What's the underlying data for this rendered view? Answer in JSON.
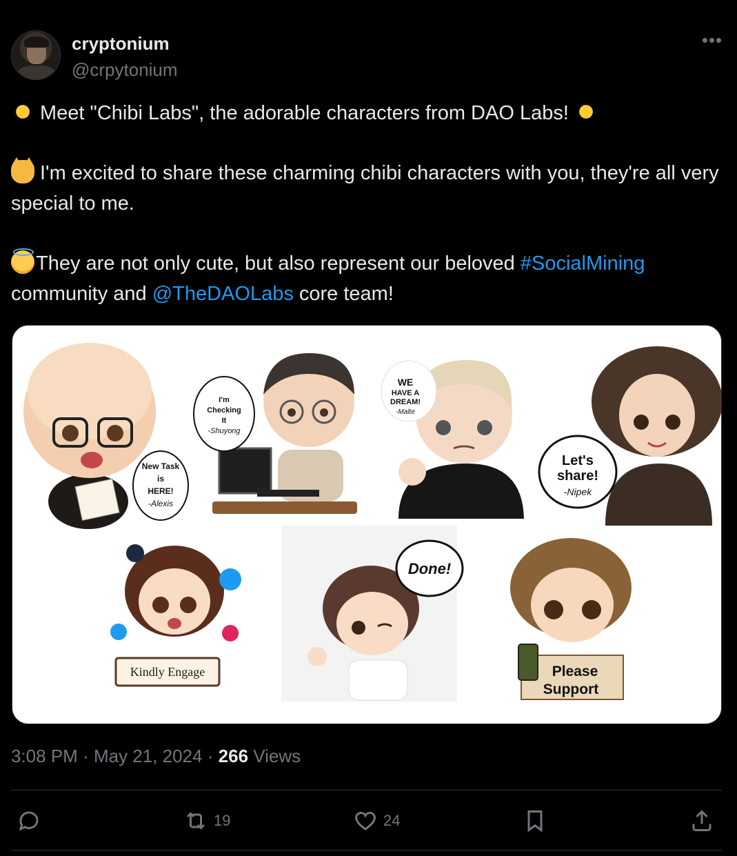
{
  "author": {
    "name": "cryptonium",
    "handle": "@crpytonium"
  },
  "tweet": {
    "line1": "Meet \"Chibi Labs\", the adorable characters from DAO Labs!",
    "line2": "I'm excited to share these charming chibi characters with you, they're all very special to me.",
    "line3_pre": "They are not only cute, but also represent our beloved ",
    "hashtag": "#SocialMining",
    "line3_mid": " community and ",
    "mention": "@TheDAOLabs",
    "line3_post": " core team!"
  },
  "media": {
    "bubbles": {
      "new_task_1": "New Task",
      "new_task_2": "is",
      "new_task_3": "HERE!",
      "new_task_sig": "-Alexis",
      "checking_1": "I'm",
      "checking_2": "Checking",
      "checking_3": "It",
      "checking_sig": "-Shuyong",
      "dream_1": "WE",
      "dream_2": "HAVE A",
      "dream_3": "DREAM!",
      "dream_sig": "-Malte",
      "share_1": "Let's",
      "share_2": "share!",
      "share_sig": "-Nipek",
      "kindly": "Kindly Engage",
      "done": "Done!",
      "please": "Please",
      "support": "Support"
    }
  },
  "meta": {
    "time": "3:08 PM",
    "sep": "·",
    "date": "May 21, 2024",
    "views_count": "266",
    "views_label": "Views"
  },
  "actions": {
    "reply_count": "",
    "retweet_count": "19",
    "like_count": "24"
  },
  "colors": {
    "background": "#000000",
    "text": "#e7e9ea",
    "muted": "#71767b",
    "link": "#1d9bf0",
    "divider": "#2f3336"
  }
}
